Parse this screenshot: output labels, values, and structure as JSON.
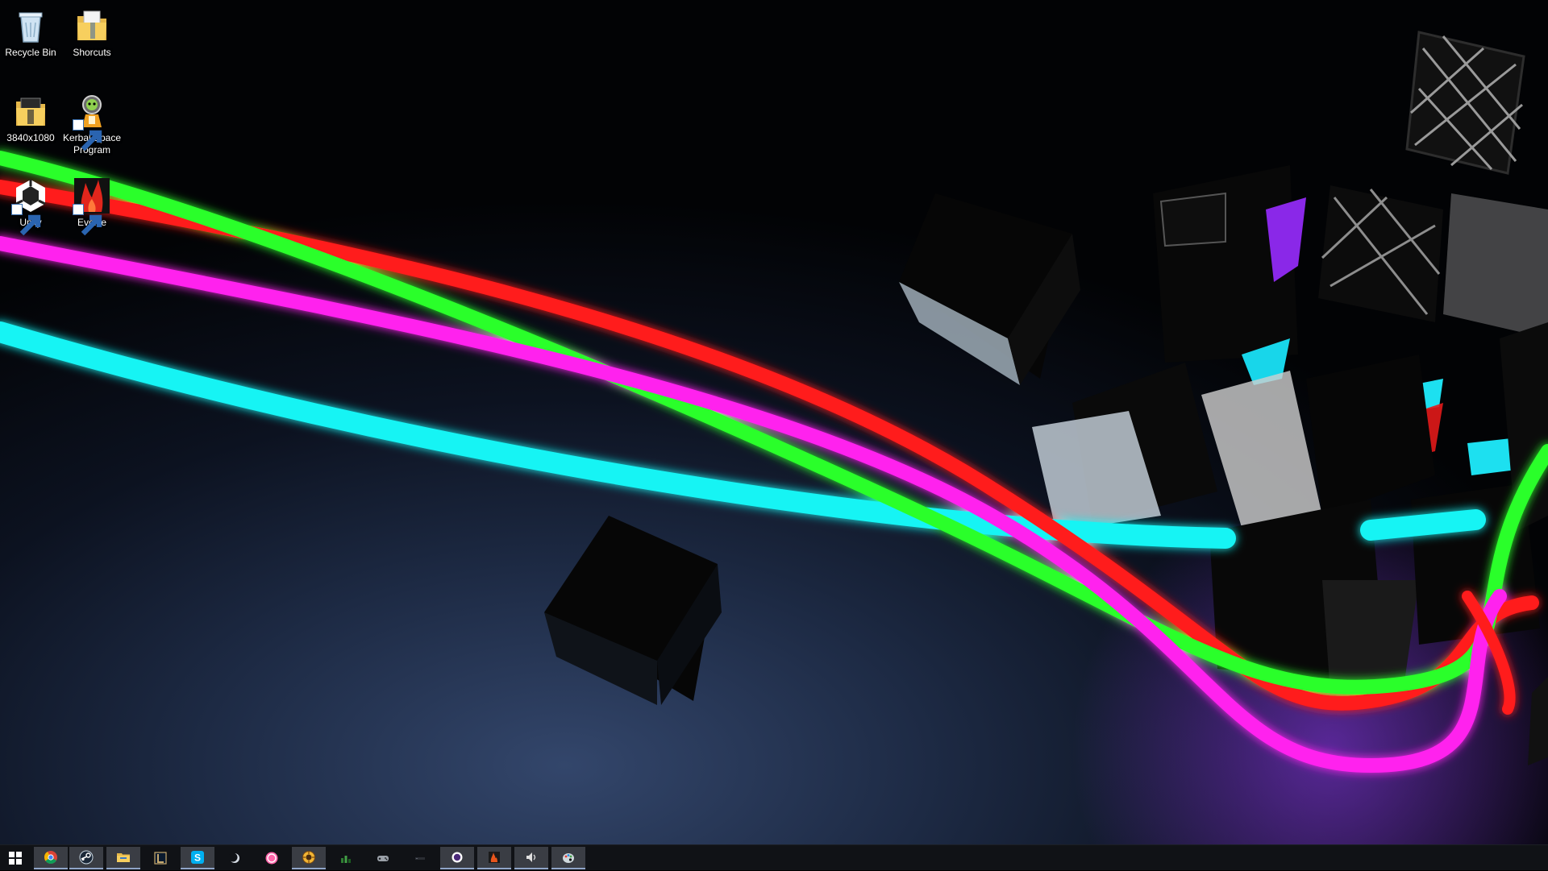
{
  "desktop": {
    "icons": [
      {
        "label": "Recycle Bin",
        "icon": "recycle-bin-icon"
      },
      {
        "label": "Shorcuts",
        "icon": "folder-icon"
      },
      {
        "label": "3840x1080",
        "icon": "folder-icon"
      },
      {
        "label": "Kerbal Space Program",
        "icon": "kerbal-space-program-icon"
      },
      {
        "label": "Unity",
        "icon": "unity-icon"
      },
      {
        "label": "Evolve",
        "icon": "evolve-icon"
      }
    ]
  },
  "taskbar": {
    "start": {
      "icon": "windows-logo-icon"
    },
    "apps": [
      {
        "icon": "chrome-icon",
        "active": true
      },
      {
        "icon": "steam-icon",
        "active": true
      },
      {
        "icon": "file-explorer-icon",
        "active": true
      },
      {
        "icon": "league-of-legends-icon",
        "active": false
      },
      {
        "icon": "skype-icon",
        "active": true
      },
      {
        "icon": "moon-app-icon",
        "active": false
      },
      {
        "icon": "osu-icon",
        "active": false
      },
      {
        "icon": "hearthstone-icon",
        "active": true
      },
      {
        "icon": "green-bars-icon",
        "active": false
      },
      {
        "icon": "gamepad-icon",
        "active": false
      },
      {
        "icon": "console-icon",
        "active": false
      },
      {
        "icon": "circle-app-icon",
        "active": true
      },
      {
        "icon": "flame-app-icon",
        "active": true
      },
      {
        "icon": "speaker-app-icon",
        "active": true
      },
      {
        "icon": "paint-app-icon",
        "active": true
      }
    ]
  },
  "colors": {
    "neon_red": "#ff1a1a",
    "neon_green": "#2cff2c",
    "neon_magenta": "#ff22ee",
    "neon_cyan": "#17f4f4",
    "taskbar_bg": "#101216",
    "active_button_bg": "#3a3d44"
  }
}
